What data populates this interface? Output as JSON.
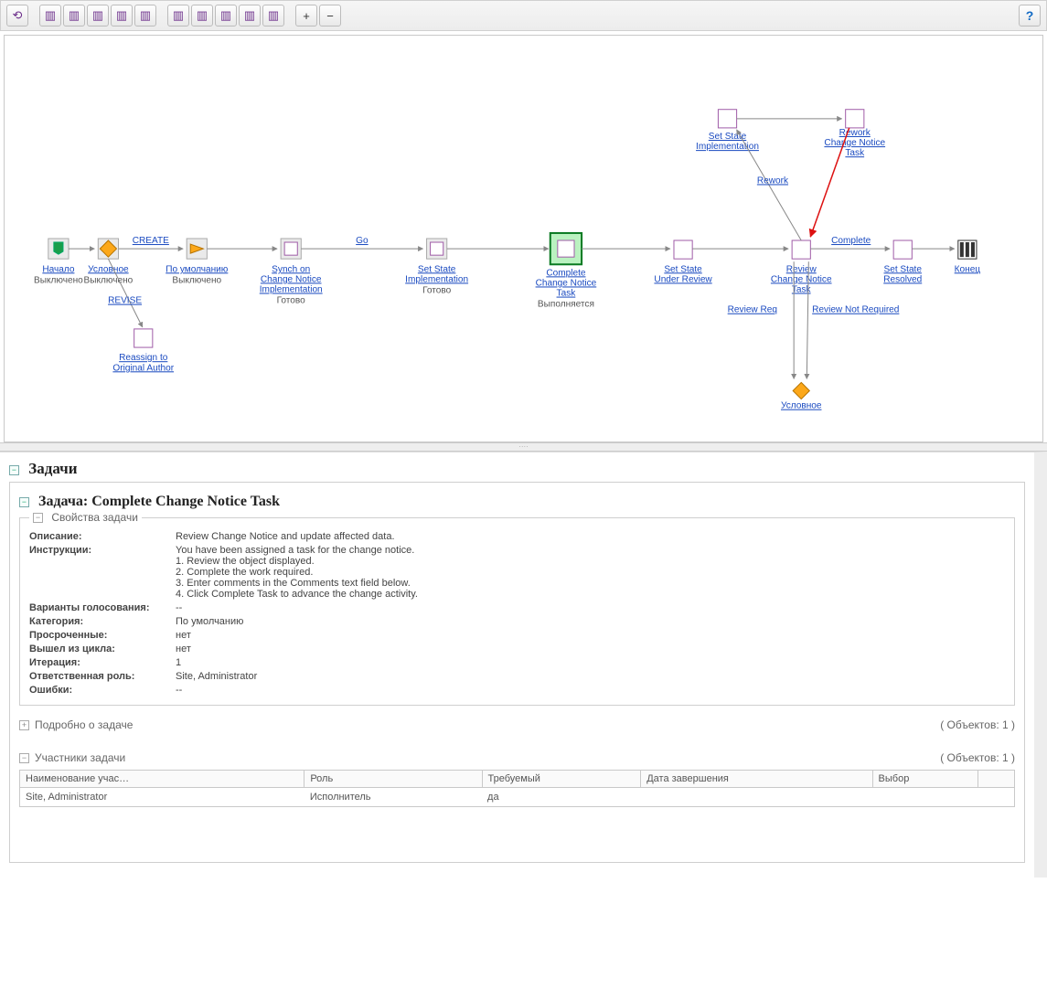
{
  "workflow": {
    "nodes": {
      "start": {
        "label": "Начало",
        "state": "Выключено"
      },
      "cond1": {
        "label": "Условное",
        "state": "Выключено"
      },
      "default": {
        "label": "По умолчанию",
        "state": "Выключено"
      },
      "reassign": {
        "label1": "Reassign to",
        "label2": "Original Author"
      },
      "synch": {
        "label1": "Synch on",
        "label2": "Change Notice",
        "label3": "Implementation",
        "state": "Готово"
      },
      "setimpl": {
        "label1": "Set State",
        "label2": "Implementation",
        "state": "Готово"
      },
      "complete": {
        "label1": "Complete",
        "label2": "Change Notice",
        "label3": "Task",
        "state": "Выполняется"
      },
      "setreview": {
        "label1": "Set State",
        "label2": "Under Review"
      },
      "setimpl2": {
        "label1": "Set State",
        "label2": "Implementation"
      },
      "rework": {
        "label1": "Rework",
        "label2": "Change Notice",
        "label3": "Task"
      },
      "reviewtask": {
        "label1": "Review",
        "label2": "Change Notice",
        "label3": "Task"
      },
      "setresolved": {
        "label1": "Set State",
        "label2": "Resolved"
      },
      "end": {
        "label": "Конец"
      },
      "cond2": {
        "label": "Условное"
      }
    },
    "edges": {
      "create": "CREATE",
      "revise": "REVISE",
      "go": "Go",
      "rework": "Rework",
      "complete": "Complete",
      "reviewreq": "Review Req",
      "reviewnotreq": "Review Not Required"
    }
  },
  "sections": {
    "tasks_heading": "Задачи",
    "task_heading": "Задача: Complete Change Notice Task",
    "props_heading": "Свойства задачи",
    "detail_heading": "Подробно о задаче",
    "detail_count": "( Объектов: 1 )",
    "participants_heading": "Участники задачи",
    "participants_count": "( Объектов: 1 )"
  },
  "props": {
    "description_lbl": "Описание:",
    "description_val": "Review Change Notice and update affected data.",
    "instructions_lbl": "Инструкции:",
    "instructions_val": "You have been assigned a task for the change notice.\n1. Review the object displayed.\n2. Complete the work required.\n3. Enter comments in the Comments text field below.\n4. Click Complete Task to advance the change activity.",
    "votes_lbl": "Варианты голосования:",
    "votes_val": "--",
    "category_lbl": "Категория:",
    "category_val": "По умолчанию",
    "overdue_lbl": "Просроченные:",
    "overdue_val": "нет",
    "outloop_lbl": "Вышел из цикла:",
    "outloop_val": "нет",
    "iteration_lbl": "Итерация:",
    "iteration_val": "1",
    "role_lbl": "Ответственная роль:",
    "role_val": "Site, Administrator",
    "errors_lbl": "Ошибки:",
    "errors_val": "--"
  },
  "participants": {
    "columns": [
      "Наименование учас…",
      "Роль",
      "Требуемый",
      "Дата завершения",
      "Выбор"
    ],
    "rows": [
      {
        "name": "Site, Administrator",
        "role": "Исполнитель",
        "required": "да",
        "completion": "",
        "choice": ""
      }
    ]
  }
}
